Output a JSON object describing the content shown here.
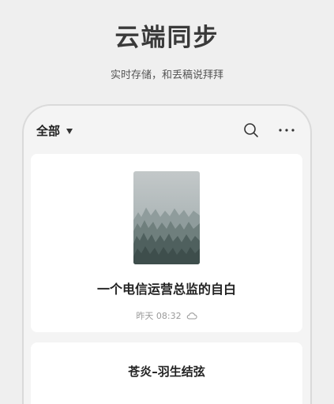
{
  "headline": "云端同步",
  "subline": "实时存储，和丢稿说拜拜",
  "toolbar": {
    "filter_label": "全部",
    "search_icon": "search-icon",
    "more_icon": "more-icon"
  },
  "notes": [
    {
      "title": "一个电信运营总监的自白",
      "timestamp": "昨天 08:32",
      "sync_icon": "cloud-icon",
      "thumbnail": "misty-forest"
    },
    {
      "title": "苍炎–羽生结弦"
    }
  ]
}
